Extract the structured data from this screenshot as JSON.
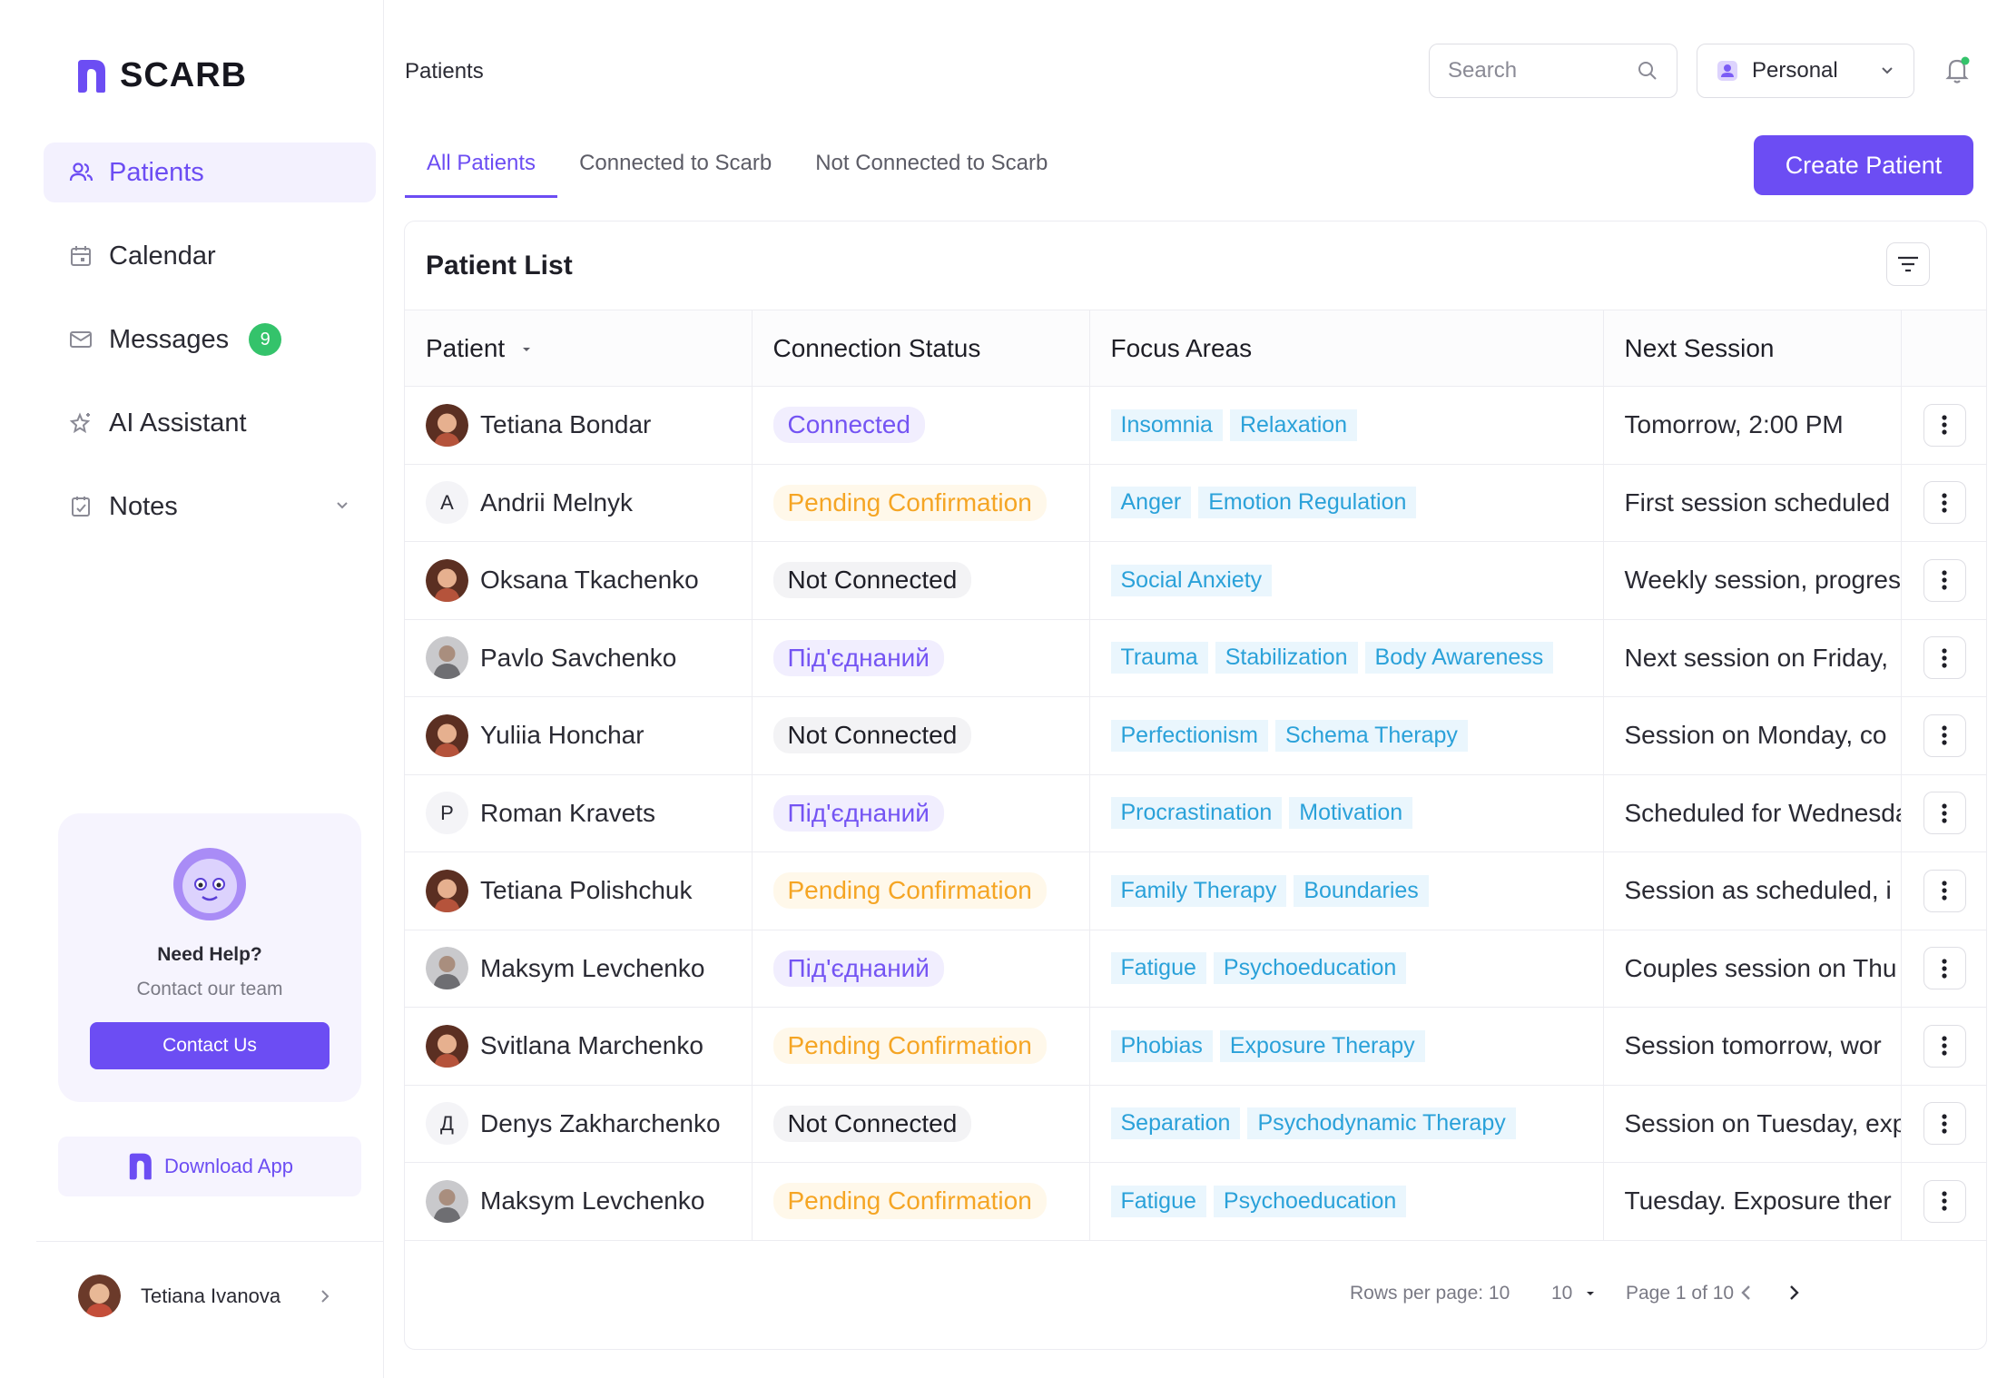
{
  "app": {
    "name": "SCARB"
  },
  "sidebar": {
    "items": [
      {
        "label": "Patients",
        "icon": "users-icon"
      },
      {
        "label": "Calendar",
        "icon": "calendar-icon"
      },
      {
        "label": "Messages",
        "icon": "mail-icon",
        "badge": "9"
      },
      {
        "label": "AI Assistant",
        "icon": "sparkle-icon"
      },
      {
        "label": "Notes",
        "icon": "notes-icon"
      }
    ],
    "help": {
      "title": "Need Help?",
      "subtitle": "Contact our team",
      "button": "Contact Us"
    },
    "download_label": "Download App",
    "user_name": "Tetiana Ivanova"
  },
  "header": {
    "breadcrumb": "Patients",
    "search_placeholder": "Search",
    "account": "Personal"
  },
  "tabs": [
    "All Patients",
    "Connected to Scarb",
    "Not Connected to Scarb"
  ],
  "create_button": "Create Patient",
  "table": {
    "title": "Patient List",
    "columns": [
      "Patient",
      "Connection Status",
      "Focus Areas",
      "Next Session"
    ],
    "rows": [
      {
        "name": "Tetiana Bondar",
        "avatar": "photo-female",
        "status": "Connected",
        "status_kind": "connected",
        "tags": [
          "Insomnia",
          "Relaxation"
        ],
        "next": "Tomorrow, 2:00 PM"
      },
      {
        "name": "Andrii Melnyk",
        "avatar": "A",
        "status": "Pending Confirmation",
        "status_kind": "pending",
        "tags": [
          "Anger",
          "Emotion Regulation"
        ],
        "next": "First session scheduled"
      },
      {
        "name": "Oksana Tkachenko",
        "avatar": "photo-female",
        "status": "Not Connected",
        "status_kind": "not",
        "tags": [
          "Social Anxiety"
        ],
        "next": "Weekly session, progress"
      },
      {
        "name": "Pavlo Savchenko",
        "avatar": "photo-male",
        "status": "Під'єднаний",
        "status_kind": "connected",
        "tags": [
          "Trauma",
          "Stabilization",
          "Body Awareness"
        ],
        "next": "Next session on Friday,"
      },
      {
        "name": "Yuliia Honchar",
        "avatar": "photo-female",
        "status": "Not Connected",
        "status_kind": "not",
        "tags": [
          "Perfectionism",
          "Schema Therapy"
        ],
        "next": "Session on Monday, co"
      },
      {
        "name": "Roman Kravets",
        "avatar": "P",
        "status": "Під'єднаний",
        "status_kind": "connected",
        "tags": [
          "Procrastination",
          "Motivation"
        ],
        "next": "Scheduled for Wednesday"
      },
      {
        "name": "Tetiana Polishchuk",
        "avatar": "photo-female",
        "status": "Pending Confirmation",
        "status_kind": "pending",
        "tags": [
          "Family Therapy",
          "Boundaries"
        ],
        "next": "Session as scheduled, i"
      },
      {
        "name": "Maksym Levchenko",
        "avatar": "photo-male",
        "status": "Під'єднаний",
        "status_kind": "connected",
        "tags": [
          "Fatigue",
          "Psychoeducation"
        ],
        "next": "Couples session on Thu"
      },
      {
        "name": "Svitlana Marchenko",
        "avatar": "photo-female",
        "status": "Pending Confirmation",
        "status_kind": "pending",
        "tags": [
          "Phobias",
          "Exposure Therapy"
        ],
        "next": "Session tomorrow, wor"
      },
      {
        "name": "Denys Zakharchenko",
        "avatar": "Д",
        "status": "Not Connected",
        "status_kind": "not",
        "tags": [
          "Separation",
          "Psychodynamic Therapy"
        ],
        "next": "Session on Tuesday, expo"
      },
      {
        "name": "Maksym Levchenko",
        "avatar": "photo-male",
        "status": "Pending Confirmation",
        "status_kind": "pending",
        "tags": [
          "Fatigue",
          "Psychoeducation"
        ],
        "next": "Tuesday. Exposure ther"
      }
    ]
  },
  "pagination": {
    "rows_per_page": "Rows per page: 10",
    "size": "10",
    "page": "Page 1 of 10"
  },
  "colors": {
    "accent": "#6c4df3",
    "tag_text": "#2aa1d9",
    "tag_bg": "#eaf6fd",
    "pending": "#f5a524",
    "badge": "#34c36b"
  }
}
